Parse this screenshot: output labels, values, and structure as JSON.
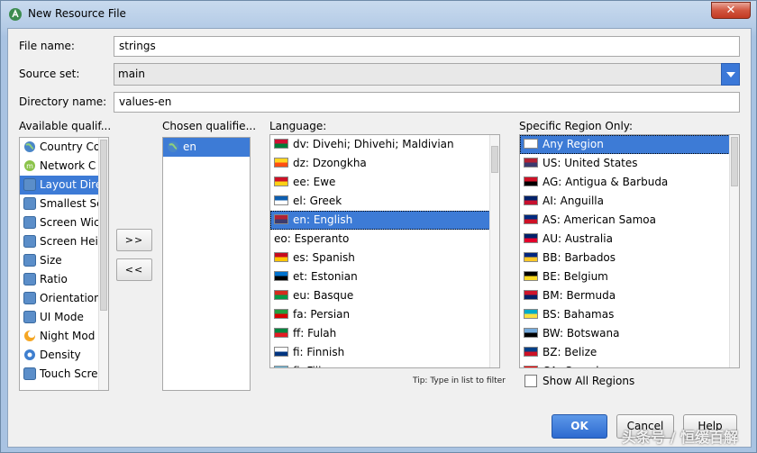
{
  "window": {
    "title": "New Resource File",
    "close_label": "✕"
  },
  "form": {
    "file_name_label": "File name:",
    "file_name_value": "strings",
    "source_set_label": "Source set:",
    "source_set_value": "main",
    "directory_label": "Directory name:",
    "directory_value": "values-en"
  },
  "columns": {
    "available": "Available qualif...",
    "chosen": "Chosen qualifie...",
    "language": "Language:",
    "region": "Specific Region Only:"
  },
  "available_qualifiers": [
    {
      "label": "Country Co",
      "icon": "globe-icon"
    },
    {
      "label": "Network C",
      "icon": "network-icon"
    },
    {
      "label": "Layout Dire",
      "icon": "layout-direction-icon"
    },
    {
      "label": "Smallest Sc",
      "icon": "smallest-screen-icon"
    },
    {
      "label": "Screen Wic",
      "icon": "screen-width-icon"
    },
    {
      "label": "Screen Hei",
      "icon": "screen-height-icon"
    },
    {
      "label": "Size",
      "icon": "size-icon"
    },
    {
      "label": "Ratio",
      "icon": "ratio-icon"
    },
    {
      "label": "Orientation",
      "icon": "orientation-icon"
    },
    {
      "label": "UI Mode",
      "icon": "ui-mode-icon"
    },
    {
      "label": "Night Mod",
      "icon": "night-mode-icon"
    },
    {
      "label": "Density",
      "icon": "density-icon"
    },
    {
      "label": "Touch Scre",
      "icon": "touch-screen-icon"
    }
  ],
  "chosen_qualifiers": [
    {
      "label": "en",
      "icon": "globe-icon"
    }
  ],
  "buttons": {
    "add": ">>",
    "remove": "<<",
    "ok": "OK",
    "cancel": "Cancel",
    "help": "Help"
  },
  "languages": [
    {
      "label": "dv: Divehi; Dhivehi; Maldivian",
      "colors": [
        "#d21034",
        "#007e3a"
      ]
    },
    {
      "label": "dz: Dzongkha",
      "colors": [
        "#ffd520",
        "#ff4e12"
      ]
    },
    {
      "label": "ee: Ewe",
      "colors": [
        "#ce1126",
        "#fcd116"
      ]
    },
    {
      "label": "el: Greek",
      "colors": [
        "#0d5eaf",
        "#ffffff"
      ]
    },
    {
      "label": "en: English",
      "colors": [
        "#b22234",
        "#3c3b6e"
      ]
    },
    {
      "label": "eo: Esperanto",
      "colors": []
    },
    {
      "label": "es: Spanish",
      "colors": [
        "#c60b1e",
        "#ffc400"
      ]
    },
    {
      "label": "et: Estonian",
      "colors": [
        "#0072ce",
        "#000000"
      ]
    },
    {
      "label": "eu: Basque",
      "colors": [
        "#d52b1e",
        "#009b48"
      ]
    },
    {
      "label": "fa: Persian",
      "colors": [
        "#239f40",
        "#da0000"
      ]
    },
    {
      "label": "ff: Fulah",
      "colors": [
        "#00853f",
        "#e31b23"
      ]
    },
    {
      "label": "fi: Finnish",
      "colors": [
        "#ffffff",
        "#003580"
      ]
    },
    {
      "label": "fj: Fijian",
      "colors": [
        "#68bfe5",
        "#012169"
      ]
    }
  ],
  "regions": [
    {
      "label": "Any Region",
      "colors": [
        "#ffffff",
        "#ffffff"
      ]
    },
    {
      "label": "US: United States",
      "colors": [
        "#b22234",
        "#3c3b6e"
      ]
    },
    {
      "label": "AG: Antigua & Barbuda",
      "colors": [
        "#ce1126",
        "#000000"
      ]
    },
    {
      "label": "AI: Anguilla",
      "colors": [
        "#012169",
        "#c8102e"
      ]
    },
    {
      "label": "AS: American Samoa",
      "colors": [
        "#002b7f",
        "#ce1126"
      ]
    },
    {
      "label": "AU: Australia",
      "colors": [
        "#012169",
        "#e4002b"
      ]
    },
    {
      "label": "BB: Barbados",
      "colors": [
        "#00267f",
        "#ffc726"
      ]
    },
    {
      "label": "BE: Belgium",
      "colors": [
        "#000000",
        "#fdda24"
      ]
    },
    {
      "label": "BM: Bermuda",
      "colors": [
        "#cf142b",
        "#012169"
      ]
    },
    {
      "label": "BS: Bahamas",
      "colors": [
        "#00abc9",
        "#fae042"
      ]
    },
    {
      "label": "BW: Botswana",
      "colors": [
        "#75aadb",
        "#000000"
      ]
    },
    {
      "label": "BZ: Belize",
      "colors": [
        "#003f87",
        "#ce1126"
      ]
    },
    {
      "label": "CA: Canada",
      "colors": [
        "#ff0000",
        "#ffffff"
      ]
    }
  ],
  "tip": "Tip: Type in list to filter",
  "show_all_regions": "Show All Regions",
  "watermark": "头条号 / 恒缓百解"
}
